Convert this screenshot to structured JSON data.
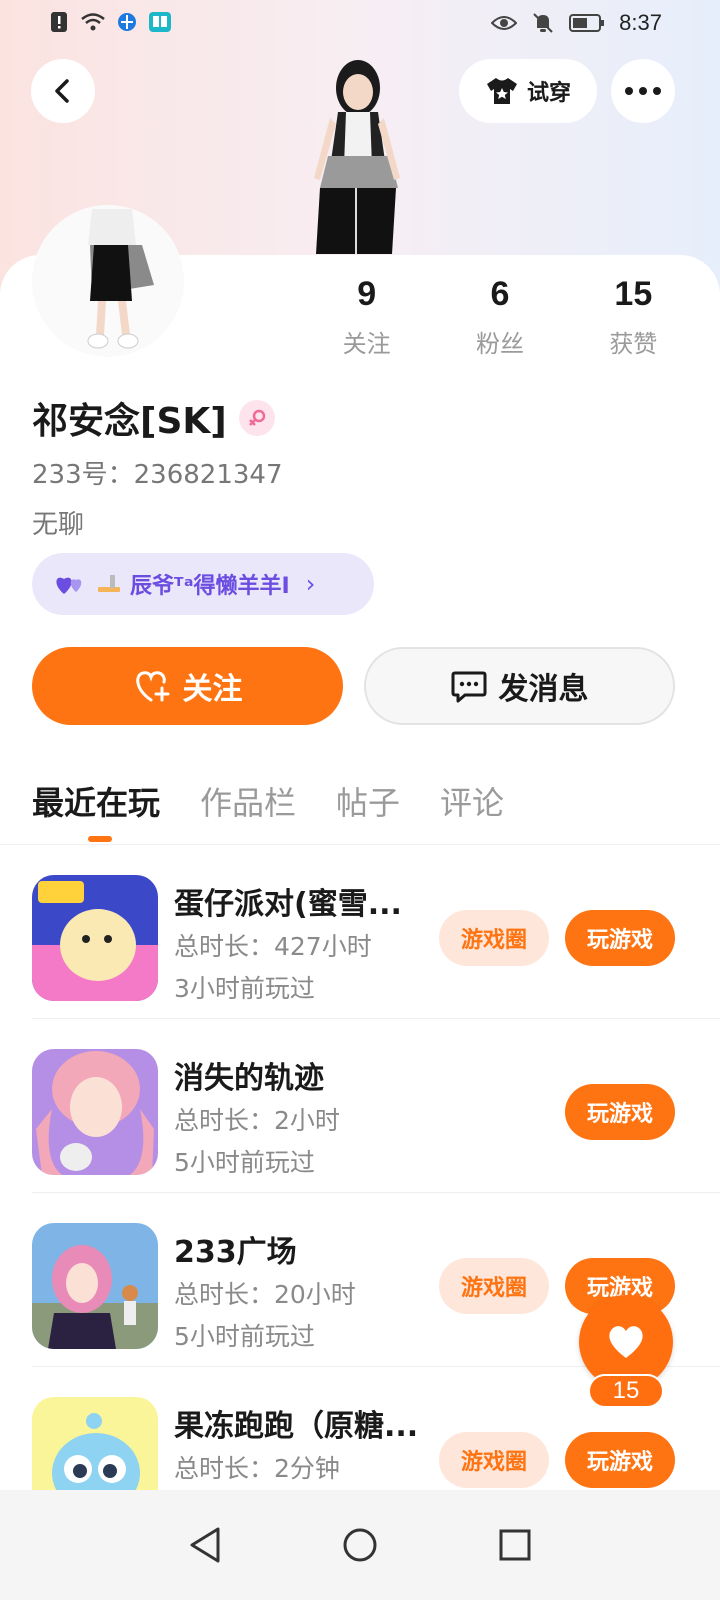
{
  "status_bar": {
    "time": "8:37",
    "left_icons": [
      "alert-icon",
      "wifi-icon",
      "browser-icon",
      "book-icon"
    ],
    "right_icons": [
      "eye-icon",
      "mute-icon",
      "battery-icon"
    ]
  },
  "header": {
    "tryon_label": "试穿"
  },
  "profile": {
    "stats": [
      {
        "value": "9",
        "label": "关注"
      },
      {
        "value": "6",
        "label": "粉丝"
      },
      {
        "value": "15",
        "label": "获赞"
      }
    ],
    "name": "祁安念[SK]",
    "gender": "female",
    "uid": "233号：236821347",
    "bio": "无聊",
    "relation_text": "辰爷ᵀᵃ得懒羊羊I"
  },
  "actions": {
    "follow_label": "关注",
    "message_label": "发消息"
  },
  "tabs": [
    {
      "label": "最近在玩",
      "active": true
    },
    {
      "label": "作品栏",
      "active": false
    },
    {
      "label": "帖子",
      "active": false
    },
    {
      "label": "评论",
      "active": false
    }
  ],
  "games": [
    {
      "title": "蛋仔派对(蜜雪...",
      "duration": "总时长：427小时",
      "last_played": "3小时前玩过",
      "has_circle": true,
      "circle_label": "游戏圈",
      "play_label": "玩游戏"
    },
    {
      "title": "消失的轨迹",
      "duration": "总时长：2小时",
      "last_played": "5小时前玩过",
      "has_circle": false,
      "circle_label": "",
      "play_label": "玩游戏"
    },
    {
      "title": "233广场",
      "duration": "总时长：20小时",
      "last_played": "5小时前玩过",
      "has_circle": true,
      "circle_label": "游戏圈",
      "play_label": "玩游戏"
    },
    {
      "title": "果冻跑跑（原糖...",
      "duration": "总时长：2分钟",
      "last_played": "",
      "has_circle": true,
      "circle_label": "游戏圈",
      "play_label": "玩游戏"
    }
  ],
  "like_fab": {
    "count": "15"
  },
  "colors": {
    "accent": "#ff7412",
    "relation_bg": "#ebe7fb",
    "relation_text": "#6b4de0"
  }
}
